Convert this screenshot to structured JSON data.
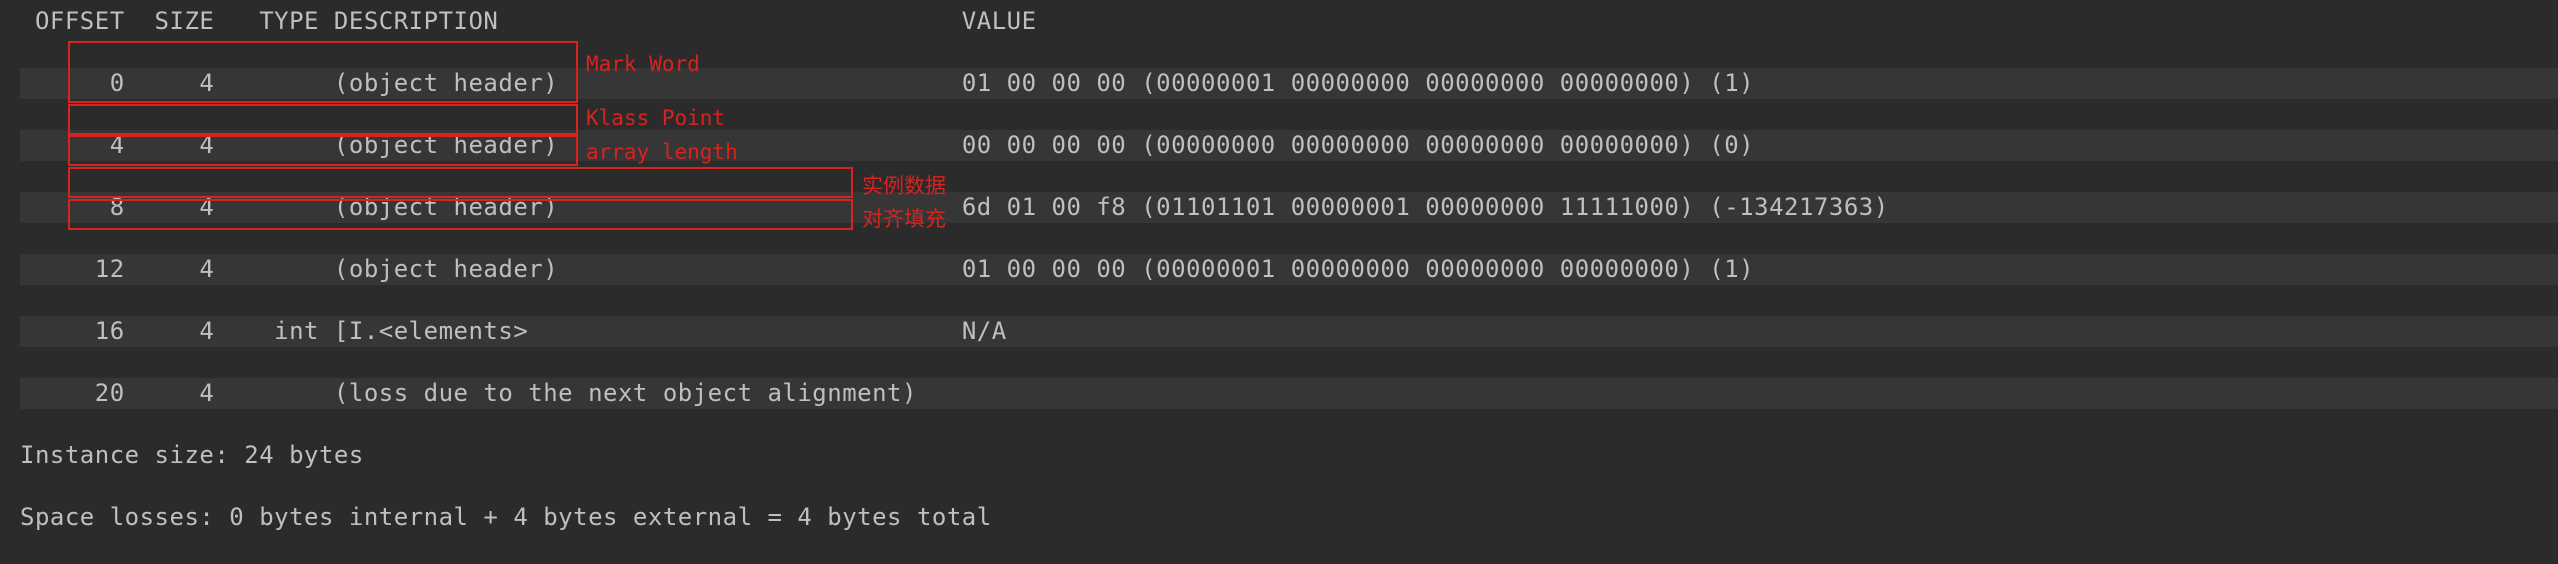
{
  "header": {
    "raw": " OFFSET  SIZE   TYPE DESCRIPTION                               VALUE"
  },
  "rows": [
    {
      "left": "      0     4        (object header)                           ",
      "value": "01 00 00 00 (00000001 00000000 00000000 00000000) (1)"
    },
    {
      "left": "      4     4        (object header)                           ",
      "value": "00 00 00 00 (00000000 00000000 00000000 00000000) (0)"
    },
    {
      "left": "      8     4        (object header)                           ",
      "value": "6d 01 00 f8 (01101101 00000001 00000000 11111000) (-134217363)"
    },
    {
      "left": "     12     4        (object header)                           ",
      "value": "01 00 00 00 (00000001 00000000 00000000 00000000) (1)"
    },
    {
      "left": "     16     4    int [I.<elements>                             ",
      "value": "N/A"
    },
    {
      "left": "     20     4        (loss due to the next object alignment)",
      "value": ""
    }
  ],
  "summary": {
    "instance_size": "Instance size: 24 bytes",
    "space_losses": "Space losses: 0 bytes internal + 4 bytes external = 4 bytes total"
  },
  "annotations": {
    "mark_word": "Mark Word",
    "klass_point": "Klass Point",
    "array_length": "array length",
    "instance_data": "实例数据",
    "alignment_padding": "对齐填充"
  }
}
